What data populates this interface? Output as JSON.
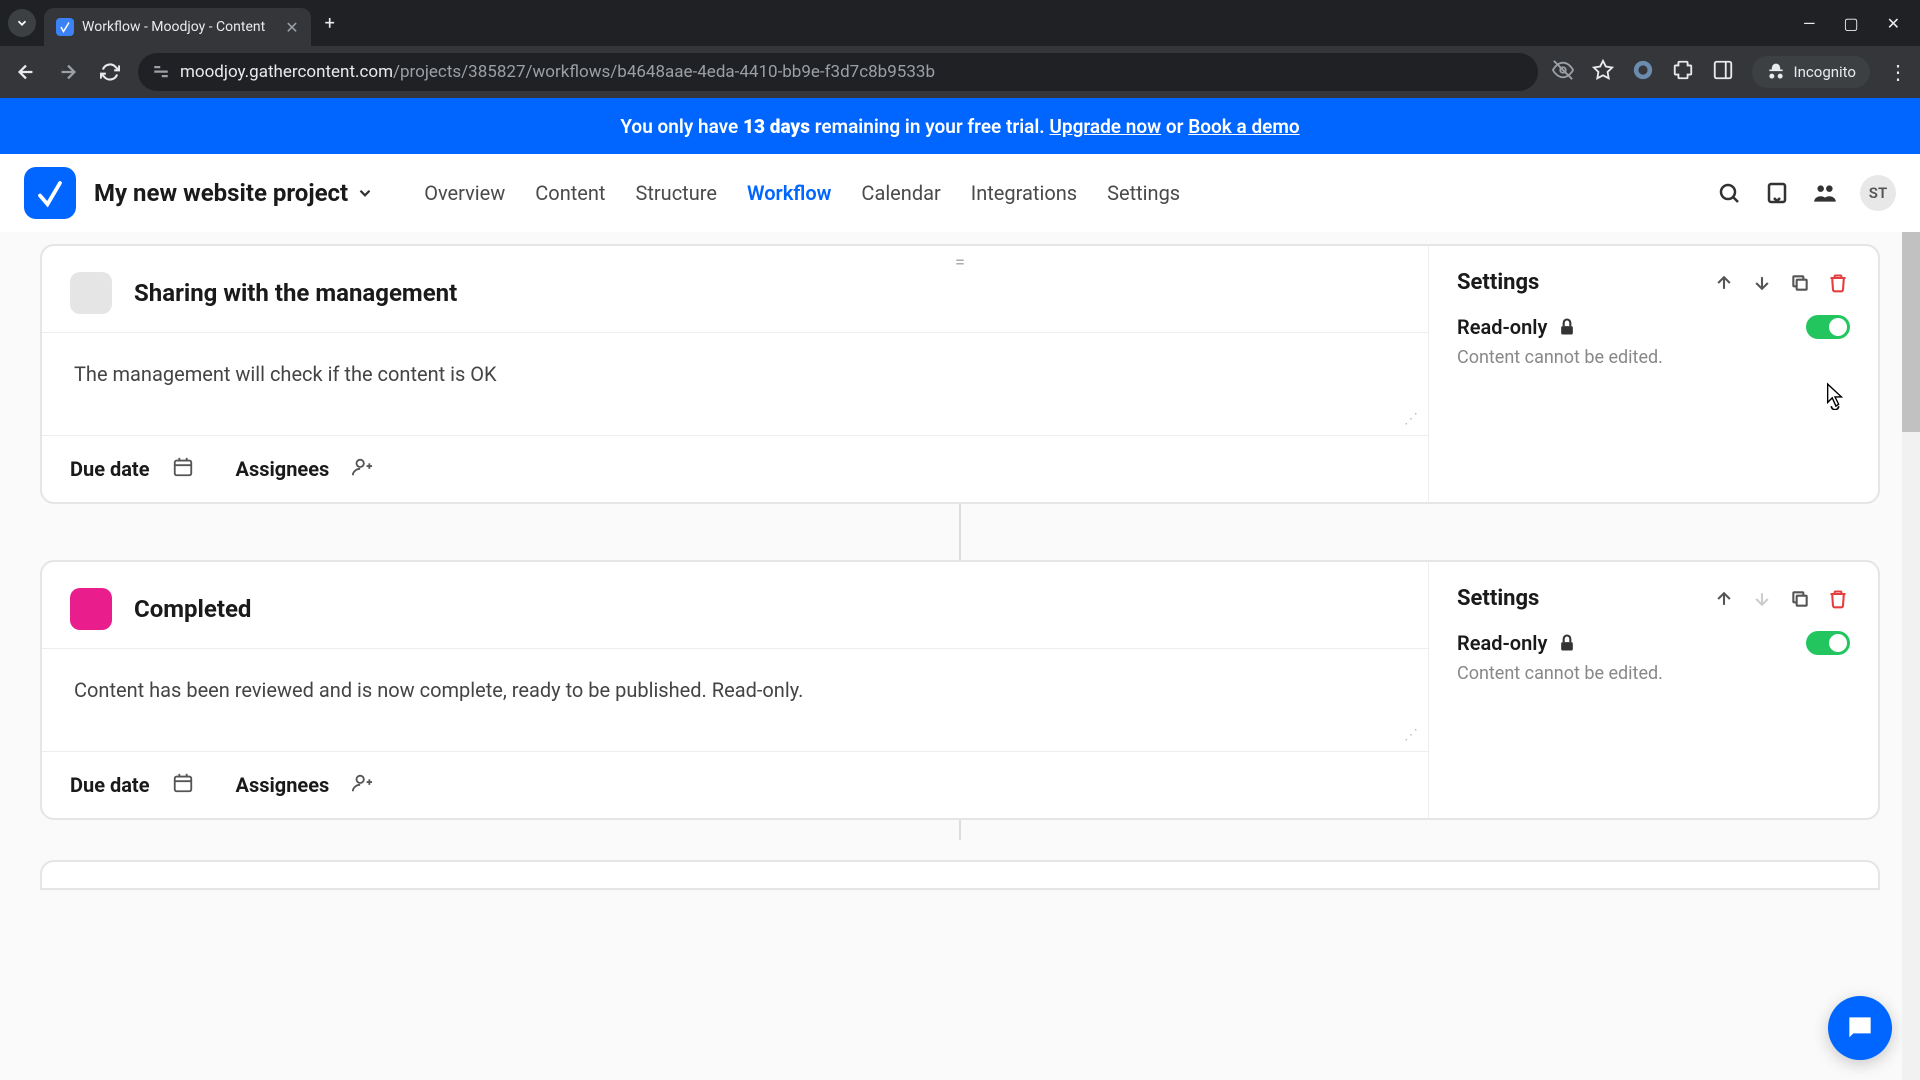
{
  "browser": {
    "tab_title": "Workflow - Moodjoy - Content",
    "url_host": "moodjoy.gathercontent.com",
    "url_path": "/projects/385827/workflows/b4648aae-4eda-4410-bb9e-f3d7c8b9533b",
    "incognito_label": "Incognito"
  },
  "banner": {
    "prefix": "You only have ",
    "days": "13 days",
    "middle": " remaining in your free trial. ",
    "upgrade": "Upgrade now",
    "or": " or ",
    "book": "Book a demo"
  },
  "header": {
    "project_name": "My new website project",
    "avatar": "ST",
    "tabs": [
      "Overview",
      "Content",
      "Structure",
      "Workflow",
      "Calendar",
      "Integrations",
      "Settings"
    ],
    "active_tab_index": 3
  },
  "stages": [
    {
      "title": "Sharing with the management",
      "color": "#e5e5e5",
      "description": "The management will check if the content is OK",
      "due_label": "Due date",
      "assignees_label": "Assignees",
      "settings_title": "Settings",
      "readonly_label": "Read-only",
      "readonly_hint": "Content cannot be edited.",
      "down_disabled": false
    },
    {
      "title": "Completed",
      "color": "#e91e8c",
      "description": "Content has been reviewed and is now complete, ready to be published. Read-only.",
      "due_label": "Due date",
      "assignees_label": "Assignees",
      "settings_title": "Settings",
      "readonly_label": "Read-only",
      "readonly_hint": "Content cannot be edited.",
      "down_disabled": true
    }
  ]
}
